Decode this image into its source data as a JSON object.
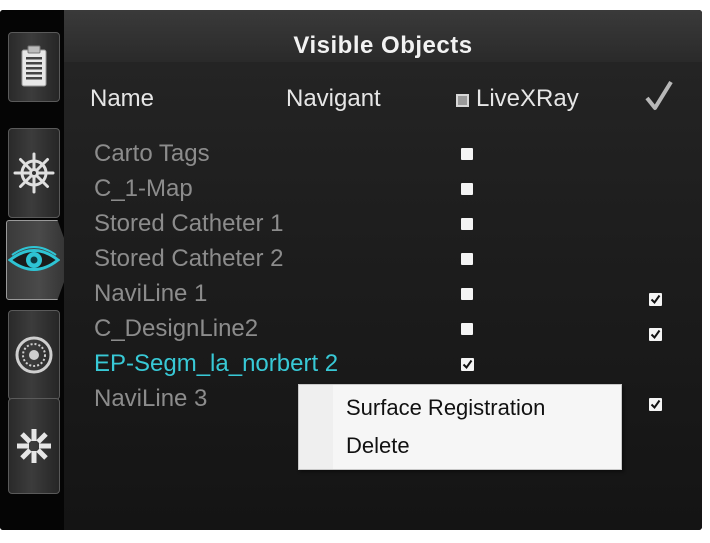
{
  "panel": {
    "title": "Visible Objects"
  },
  "columns": {
    "name": "Name",
    "navigant": "Navigant",
    "livexray": "LiveXRay",
    "visible_mark": "✓"
  },
  "rows": [
    {
      "name": "Carto Tags",
      "livexray_checked": false,
      "livexray_box": true,
      "visible": false,
      "selected": false
    },
    {
      "name": "C_1-Map",
      "livexray_checked": false,
      "livexray_box": true,
      "visible": false,
      "selected": false
    },
    {
      "name": "Stored Catheter 1",
      "livexray_checked": false,
      "livexray_box": true,
      "visible": false,
      "selected": false
    },
    {
      "name": "Stored Catheter 2",
      "livexray_checked": false,
      "livexray_box": true,
      "visible": false,
      "selected": false
    },
    {
      "name": "NaviLine 1",
      "livexray_checked": false,
      "livexray_box": true,
      "visible": true,
      "selected": false
    },
    {
      "name": "C_DesignLine2",
      "livexray_checked": false,
      "livexray_box": true,
      "visible": true,
      "selected": false
    },
    {
      "name": "EP-Segm_la_norbert 2",
      "livexray_checked": true,
      "livexray_box": true,
      "visible": false,
      "selected": true
    },
    {
      "name": "NaviLine 3",
      "livexray_checked": false,
      "livexray_box": false,
      "visible": true,
      "selected": false
    }
  ],
  "context_menu": {
    "items": [
      "Surface Registration",
      "Delete"
    ]
  },
  "sidebar": {
    "tools": [
      {
        "icon": "clipboard-icon",
        "active": false
      },
      {
        "icon": "ship-wheel-icon",
        "active": false
      },
      {
        "icon": "eye-icon",
        "active": true
      },
      {
        "icon": "dial-icon",
        "active": false
      },
      {
        "icon": "starburst-icon",
        "active": false
      }
    ]
  },
  "colors": {
    "background": "#0d0d0d",
    "text_dim": "#8c8c8c",
    "text_header": "#e6e6e6",
    "selected": "#38c9d6",
    "accent_eye": "#2ec4d4"
  }
}
